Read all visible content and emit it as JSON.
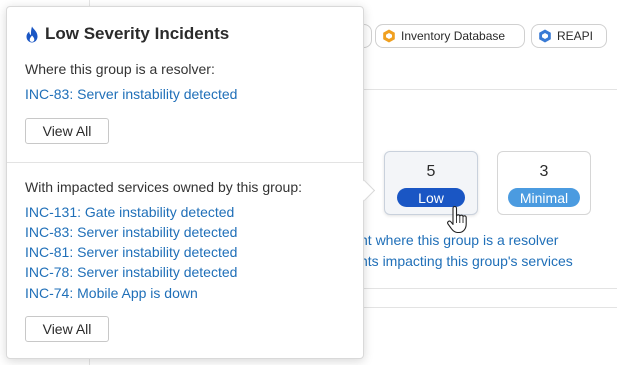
{
  "background": {
    "chips": [
      {
        "label": "",
        "icon": "hex-icon"
      },
      {
        "label": "Inventory Database",
        "icon": "hex-orange-icon",
        "icon_color": "#f0a020"
      },
      {
        "label": "REAPI",
        "icon": "hex-blue-icon",
        "icon_color": "#3a7bd5"
      }
    ],
    "severity_cards": [
      {
        "count": "5",
        "label": "Low",
        "badge_color": "#1a56c4"
      },
      {
        "count": "3",
        "label": "Minimal",
        "badge_color": "#4b9be0"
      }
    ],
    "links": [
      "nt where this group is a resolver",
      "nts impacting this group's services"
    ]
  },
  "popover": {
    "title": "Low Severity Incidents",
    "title_icon": "flame-icon",
    "accent_color": "#1a56c4",
    "resolver_section": {
      "label": "Where this group is a resolver:",
      "incidents": [
        "INC-83: Server instability detected"
      ],
      "view_all": "View All"
    },
    "impacted_section": {
      "label": "With impacted services owned by this group:",
      "incidents": [
        "INC-131: Gate instability detected",
        "INC-83: Server instability detected",
        "INC-81: Server instability detected",
        "INC-78: Server instability detected",
        "INC-74: Mobile App is down"
      ],
      "view_all": "View All"
    }
  },
  "colors": {
    "link": "#1f6fb8",
    "border": "#d9d9d9"
  }
}
